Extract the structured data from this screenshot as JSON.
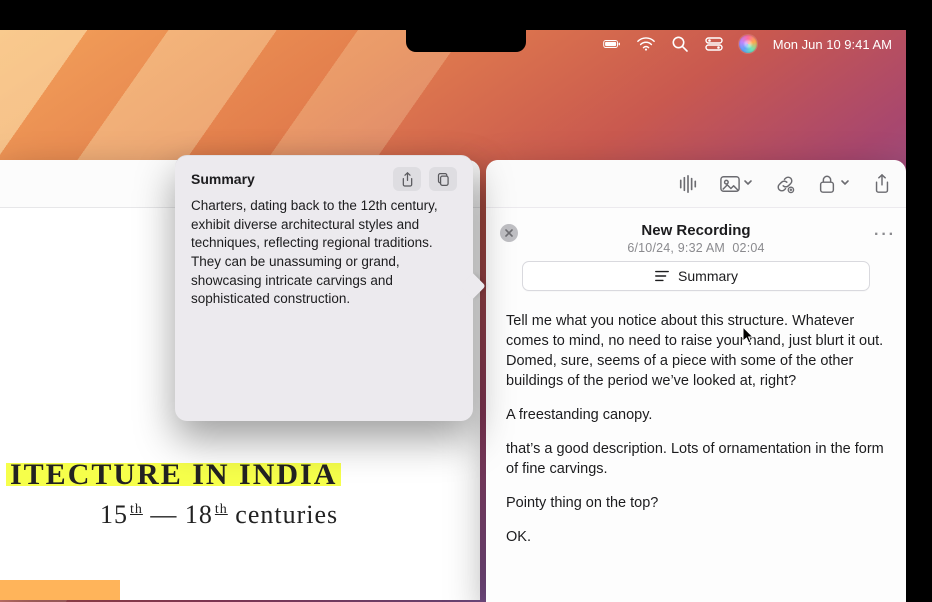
{
  "menubar": {
    "datetime": "Mon Jun 10  9:41 AM",
    "icons": [
      "battery-icon",
      "wifi-icon",
      "search-icon",
      "control-center-icon",
      "siri-icon"
    ]
  },
  "notes": {
    "handwriting_line1": "ITECTURE IN INDIA",
    "handwriting_line2_pre": "15",
    "handwriting_line2_sup1": "th",
    "handwriting_line2_mid": " — 18",
    "handwriting_line2_sup2": "th",
    "handwriting_line2_post": " centuries"
  },
  "popover": {
    "title": "Summary",
    "body": "Charters, dating back to the 12th century, exhibit diverse architectural styles and techniques, reflecting regional traditions. They can be unassuming or grand, showcasing intricate carvings and sophisticated construction."
  },
  "panel": {
    "title": "New Recording",
    "date": "6/10/24, 9:32 AM",
    "duration": "02:04",
    "summary_button": "Summary",
    "transcript": {
      "p1": "Tell me what you notice about this structure. Whatever comes to mind, no need to raise your hand, just blurt it out. Domed, sure, seems of a piece with some of the other buildings of the period we’ve looked at, right?",
      "p2": "A freestanding canopy.",
      "p3": "that’s a good description. Lots of ornamentation in the form of fine carvings.",
      "p4": "Pointy thing on the top?",
      "p5": "OK."
    }
  }
}
